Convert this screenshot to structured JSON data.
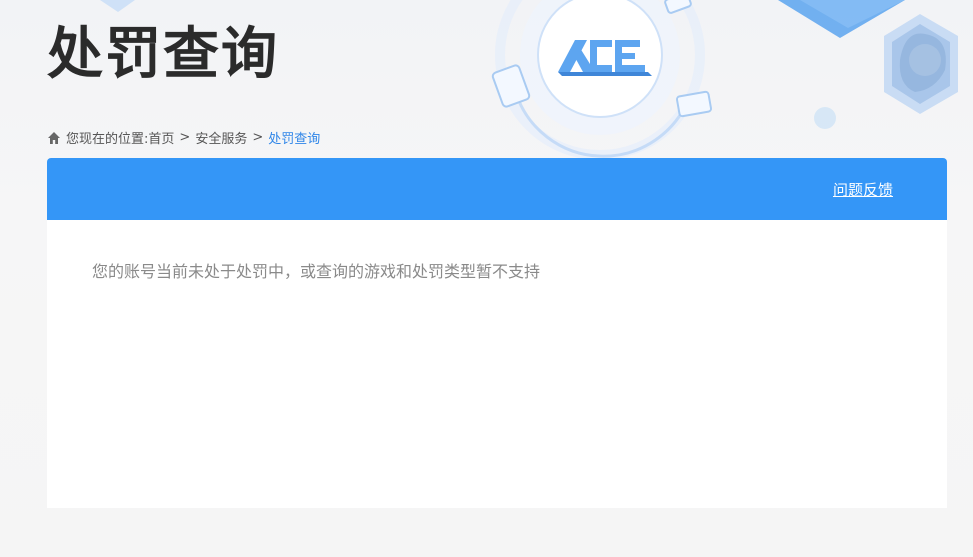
{
  "page": {
    "title": "处罚查询",
    "logo_text": "ACE"
  },
  "breadcrumb": {
    "prefix": "您现在的位置:",
    "items": [
      "首页",
      "安全服务"
    ],
    "separator": ">",
    "current": "处罚查询"
  },
  "panel": {
    "feedback_label": "问题反馈",
    "notice": "您的账号当前未处于处罚中，或查询的游戏和处罚类型暂不支持"
  },
  "colors": {
    "header_blue": "#3496f7",
    "breadcrumb_current": "#2f86e8",
    "title": "#2b2b2b",
    "notice_text": "#8a8a8a"
  },
  "icons": [
    "home-icon",
    "ace-logo",
    "game-device-icon"
  ]
}
